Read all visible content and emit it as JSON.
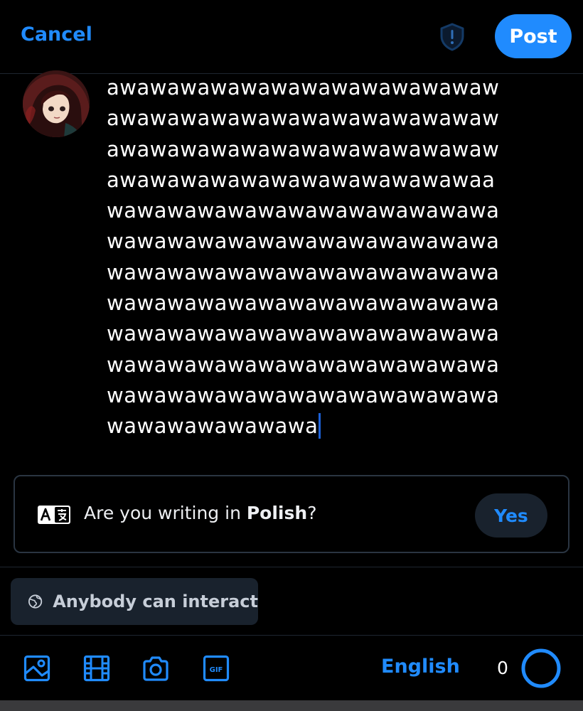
{
  "header": {
    "cancel_label": "Cancel",
    "post_label": "Post",
    "moderation_icon": "shield-exclamation-icon"
  },
  "compose": {
    "lines": [
      "awawawawawawawawawawawawaw",
      "awawawawawawawawawawawawaw",
      "awawawawawawawawawawawawaw",
      "awawawawawawawawawawawawaa",
      "wawawawawawawawawawawawawa",
      "wawawawawawawawawawawawawa",
      "wawawawawawawawawawawawawa",
      "wawawawawawawawawawawawawa",
      "wawawawawawawawawawawawawa",
      "wawawawawawawawawawawawawa",
      "wawawawawawawawawawawawawa",
      "wawawawawawawa"
    ]
  },
  "language_prompt": {
    "question_prefix": "Are you writing in ",
    "language": "Polish",
    "question_suffix": "?",
    "yes_label": "Yes",
    "icon": "translate-icon"
  },
  "interaction": {
    "label": "Anybody can interact",
    "icon": "globe-icon"
  },
  "toolbar": {
    "icons": [
      "image-icon",
      "video-icon",
      "camera-icon",
      "gif-icon"
    ],
    "language_label": "English",
    "char_count": "0"
  },
  "colors": {
    "accent": "#208bfe",
    "background": "#000000",
    "card_border": "#2a3542",
    "chip_bg": "#19222d"
  }
}
